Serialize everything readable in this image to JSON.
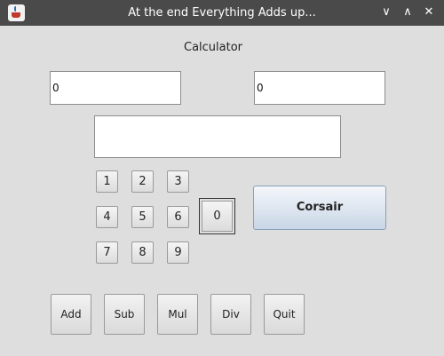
{
  "window": {
    "title": "At the end Everything Adds up...",
    "controls": {
      "minimize": "∨",
      "maximize": "∧",
      "close": "✕"
    }
  },
  "main": {
    "heading": "Calculator",
    "left_field_value": "0",
    "right_field_value": "0",
    "result_value": "",
    "digits": [
      "1",
      "2",
      "3",
      "4",
      "5",
      "6",
      "7",
      "8",
      "9"
    ],
    "zero": "0",
    "corsair_label": "Corsair",
    "ops": [
      "Add",
      "Sub",
      "Mul",
      "Div",
      "Quit"
    ]
  }
}
